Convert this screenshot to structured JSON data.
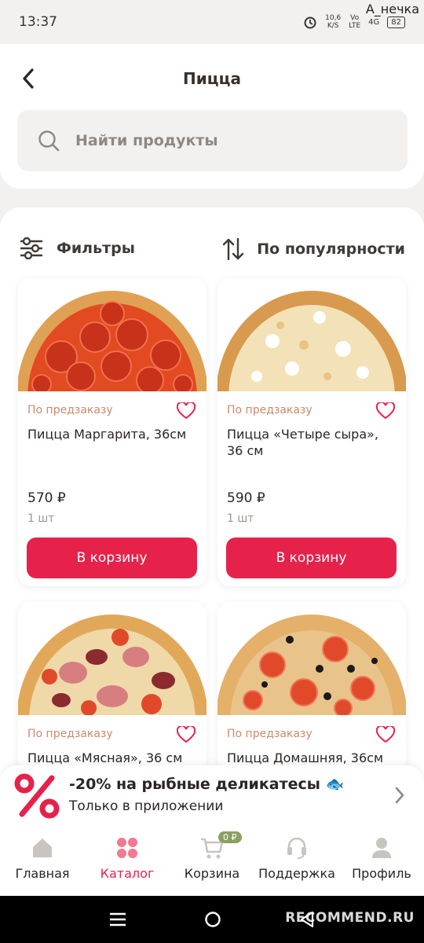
{
  "status_bar": {
    "time": "13:37",
    "speed_value": "10,6",
    "speed_unit": "K/S",
    "network_top": "Vo",
    "network_bottom": "LTE",
    "signal": "4G",
    "battery": "82",
    "watermark_user": "А_нечка"
  },
  "header": {
    "title": "Пицца",
    "search_placeholder": "Найти продукты"
  },
  "toolbar": {
    "filters_label": "Фильтры",
    "sort_label": "По популярности"
  },
  "products": [
    {
      "status": "По предзаказу",
      "name": "Пицца Маргарита, 36см",
      "price": "570 ₽",
      "unit": "1 шт",
      "button": "В корзину"
    },
    {
      "status": "По предзаказу",
      "name": "Пицца «Четыре сыра», 36 см",
      "price": "590 ₽",
      "unit": "1 шт",
      "button": "В корзину"
    },
    {
      "status": "По предзаказу",
      "name": "Пицца «Мясная», 36 см"
    },
    {
      "status": "По предзаказу",
      "name": "Пицца Домашняя, 36см"
    }
  ],
  "promo": {
    "title": "-20% на рыбные деликатесы 🐟",
    "subtitle": "Только в приложении"
  },
  "nav": {
    "items": [
      {
        "label": "Главная",
        "icon": "home-icon"
      },
      {
        "label": "Каталог",
        "icon": "catalog-icon"
      },
      {
        "label": "Корзина",
        "icon": "cart-icon"
      },
      {
        "label": "Поддержка",
        "icon": "support-icon"
      },
      {
        "label": "Профиль",
        "icon": "profile-icon"
      }
    ],
    "cart_badge": "0 ₽"
  },
  "system": {
    "watermark": "RECOMMEND.RU"
  },
  "colors": {
    "accent": "#e6224b",
    "status_text": "#c98a6c",
    "badge": "#8aa061"
  }
}
